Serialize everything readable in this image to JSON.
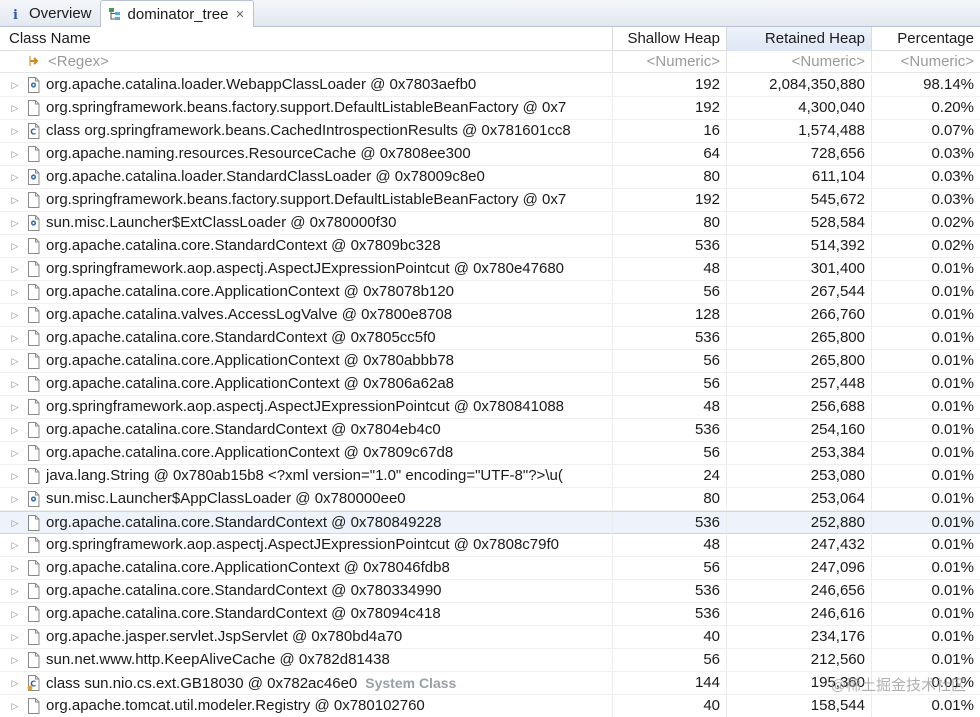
{
  "tabs": [
    {
      "label": "Overview",
      "icon": "info-icon",
      "active": false
    },
    {
      "label": "dominator_tree",
      "icon": "tree-icon",
      "active": true,
      "closable": true
    }
  ],
  "columns": {
    "class_name": "Class Name",
    "shallow_heap": "Shallow Heap",
    "retained_heap": "Retained Heap",
    "percentage": "Percentage"
  },
  "filters": {
    "class_name": "<Regex>",
    "shallow_heap": "<Numeric>",
    "retained_heap": "<Numeric>",
    "percentage": "<Numeric>"
  },
  "rows": [
    {
      "name": "org.apache.catalina.loader.WebappClassLoader @ 0x7803aefb0",
      "shallow": "192",
      "retained": "2,084,350,880",
      "percent": "98.14%",
      "icon": "classloader-icon"
    },
    {
      "name": "org.springframework.beans.factory.support.DefaultListableBeanFactory @ 0x7",
      "shallow": "192",
      "retained": "4,300,040",
      "percent": "0.20%",
      "icon": "object-icon"
    },
    {
      "name": "class org.springframework.beans.CachedIntrospectionResults @ 0x781601cc8",
      "shallow": "16",
      "retained": "1,574,488",
      "percent": "0.07%",
      "icon": "class-icon"
    },
    {
      "name": "org.apache.naming.resources.ResourceCache @ 0x7808ee300",
      "shallow": "64",
      "retained": "728,656",
      "percent": "0.03%",
      "icon": "object-icon"
    },
    {
      "name": "org.apache.catalina.loader.StandardClassLoader @ 0x78009c8e0",
      "shallow": "80",
      "retained": "611,104",
      "percent": "0.03%",
      "icon": "classloader-icon"
    },
    {
      "name": "org.springframework.beans.factory.support.DefaultListableBeanFactory @ 0x7",
      "shallow": "192",
      "retained": "545,672",
      "percent": "0.03%",
      "icon": "object-icon"
    },
    {
      "name": "sun.misc.Launcher$ExtClassLoader @ 0x780000f30",
      "shallow": "80",
      "retained": "528,584",
      "percent": "0.02%",
      "icon": "classloader-icon"
    },
    {
      "name": "org.apache.catalina.core.StandardContext @ 0x7809bc328",
      "shallow": "536",
      "retained": "514,392",
      "percent": "0.02%",
      "icon": "object-icon"
    },
    {
      "name": "org.springframework.aop.aspectj.AspectJExpressionPointcut @ 0x780e47680",
      "shallow": "48",
      "retained": "301,400",
      "percent": "0.01%",
      "icon": "object-icon"
    },
    {
      "name": "org.apache.catalina.core.ApplicationContext @ 0x78078b120",
      "shallow": "56",
      "retained": "267,544",
      "percent": "0.01%",
      "icon": "object-icon"
    },
    {
      "name": "org.apache.catalina.valves.AccessLogValve @ 0x7800e8708",
      "shallow": "128",
      "retained": "266,760",
      "percent": "0.01%",
      "icon": "object-icon"
    },
    {
      "name": "org.apache.catalina.core.StandardContext @ 0x7805cc5f0",
      "shallow": "536",
      "retained": "265,800",
      "percent": "0.01%",
      "icon": "object-icon"
    },
    {
      "name": "org.apache.catalina.core.ApplicationContext @ 0x780abbb78",
      "shallow": "56",
      "retained": "265,800",
      "percent": "0.01%",
      "icon": "object-icon"
    },
    {
      "name": "org.apache.catalina.core.ApplicationContext @ 0x7806a62a8",
      "shallow": "56",
      "retained": "257,448",
      "percent": "0.01%",
      "icon": "object-icon"
    },
    {
      "name": "org.springframework.aop.aspectj.AspectJExpressionPointcut @ 0x780841088",
      "shallow": "48",
      "retained": "256,688",
      "percent": "0.01%",
      "icon": "object-icon"
    },
    {
      "name": "org.apache.catalina.core.StandardContext @ 0x7804eb4c0",
      "shallow": "536",
      "retained": "254,160",
      "percent": "0.01%",
      "icon": "object-icon"
    },
    {
      "name": "org.apache.catalina.core.ApplicationContext @ 0x7809c67d8",
      "shallow": "56",
      "retained": "253,384",
      "percent": "0.01%",
      "icon": "object-icon"
    },
    {
      "name": "java.lang.String @ 0x780ab15b8  <?xml version=\"1.0\" encoding=\"UTF-8\"?>\\u(",
      "shallow": "24",
      "retained": "253,080",
      "percent": "0.01%",
      "icon": "object-icon"
    },
    {
      "name": "sun.misc.Launcher$AppClassLoader @ 0x780000ee0",
      "shallow": "80",
      "retained": "253,064",
      "percent": "0.01%",
      "icon": "classloader-icon"
    },
    {
      "name": "org.apache.catalina.core.StandardContext @ 0x780849228",
      "shallow": "536",
      "retained": "252,880",
      "percent": "0.01%",
      "icon": "object-icon",
      "highlight": true
    },
    {
      "name": "org.springframework.aop.aspectj.AspectJExpressionPointcut @ 0x7808c79f0",
      "shallow": "48",
      "retained": "247,432",
      "percent": "0.01%",
      "icon": "object-icon"
    },
    {
      "name": "org.apache.catalina.core.ApplicationContext @ 0x78046fdb8",
      "shallow": "56",
      "retained": "247,096",
      "percent": "0.01%",
      "icon": "object-icon"
    },
    {
      "name": "org.apache.catalina.core.StandardContext @ 0x780334990",
      "shallow": "536",
      "retained": "246,656",
      "percent": "0.01%",
      "icon": "object-icon"
    },
    {
      "name": "org.apache.catalina.core.StandardContext @ 0x78094c418",
      "shallow": "536",
      "retained": "246,616",
      "percent": "0.01%",
      "icon": "object-icon"
    },
    {
      "name": "org.apache.jasper.servlet.JspServlet @ 0x780bd4a70",
      "shallow": "40",
      "retained": "234,176",
      "percent": "0.01%",
      "icon": "object-icon"
    },
    {
      "name": "sun.net.www.http.KeepAliveCache @ 0x782d81438",
      "shallow": "56",
      "retained": "212,560",
      "percent": "0.01%",
      "icon": "object-icon"
    },
    {
      "name": "class sun.nio.cs.ext.GB18030 @ 0x782ac46e0",
      "tag": "System Class",
      "shallow": "144",
      "retained": "195,360",
      "percent": "0.01%",
      "icon": "system-class-icon"
    },
    {
      "name": "org.apache.tomcat.util.modeler.Registry @ 0x780102760",
      "shallow": "40",
      "retained": "158,544",
      "percent": "0.01%",
      "icon": "object-icon"
    }
  ],
  "watermark": "@稀土掘金技术社区",
  "colors": {
    "tab_border": "#b9c3d3",
    "sorted_header": "#dde6f4",
    "highlight_row": "#eef3fb",
    "filter_text": "#9a9a9a"
  }
}
